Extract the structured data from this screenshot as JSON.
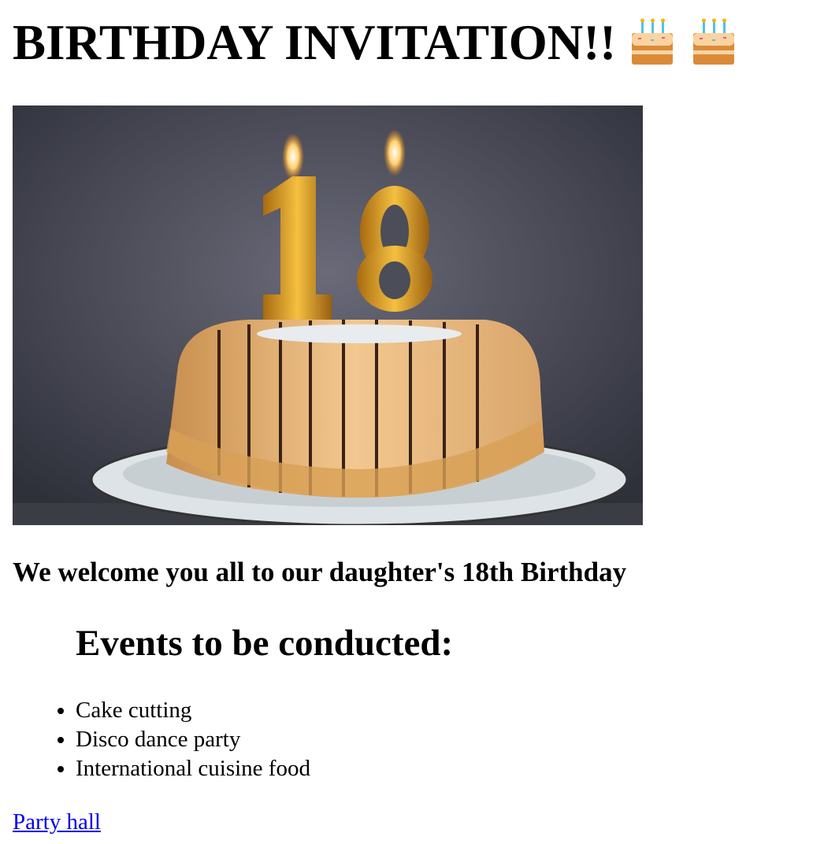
{
  "title": "BIRTHDAY INVITATION!!",
  "title_icons": [
    "birthday-cake-emoji",
    "birthday-cake-emoji"
  ],
  "welcome": "We welcome you all to our daughter's 18th Birthday",
  "events_heading": "Events to be conducted:",
  "events": [
    "Cake cutting",
    "Disco dance party",
    "International cuisine food"
  ],
  "link": "Party hall",
  "colors": {
    "link": "#0000ee"
  }
}
